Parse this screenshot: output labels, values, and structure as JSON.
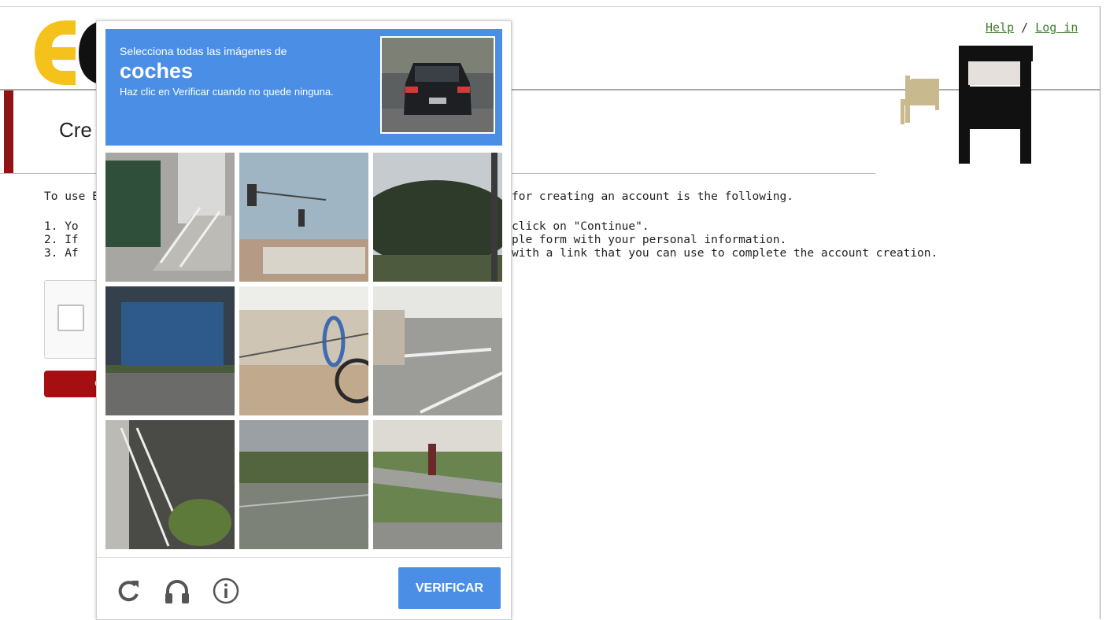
{
  "header": {
    "help_link": "Help",
    "separator": " / ",
    "login_link": "Log in"
  },
  "page": {
    "title": "Cre",
    "intro_left": "To use E",
    "intro_right": "for creating an account is the following.",
    "steps_left": [
      "1. Yo",
      "2. If",
      "3. Af"
    ],
    "steps_right": [
      "click on \"Continue\".",
      "ple form with your personal information.",
      "with a link that you can use to complete the account creation."
    ],
    "continue_label": "C"
  },
  "captcha": {
    "instruction_line1": "Selecciona todas las imágenes de",
    "target": "coches",
    "instruction_line3": "Haz clic en Verificar cuando no quede ninguna.",
    "verify_label": "VERIFICAR",
    "icons": [
      "reload-icon",
      "headphones-icon",
      "info-icon"
    ]
  },
  "colors": {
    "captcha_blue": "#4a8ee6",
    "brand_red": "#a50f12",
    "link_green": "#3e7d2e"
  }
}
